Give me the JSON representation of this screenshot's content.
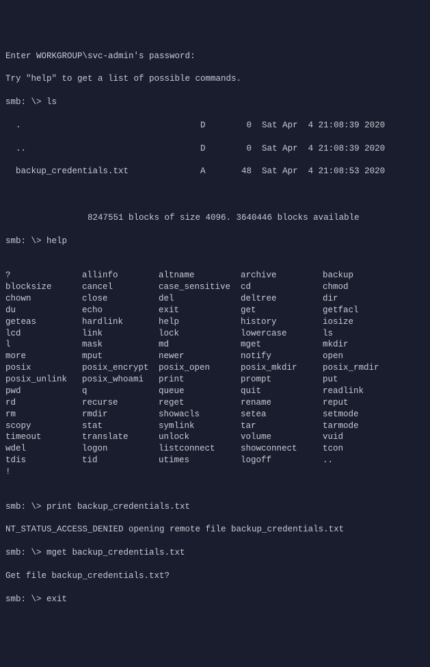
{
  "header": {
    "l1": "Enter WORKGROUP\\svc-admin's password:",
    "l2": "Try \"help\" to get a list of possible commands."
  },
  "prompt": "smb: \\> ",
  "cmds": {
    "ls": "ls",
    "help": "help",
    "print": "print backup_credentials.txt",
    "mget": "mget backup_credentials.txt",
    "exit": "exit"
  },
  "listing": {
    "r1": "  .                                   D        0  Sat Apr  4 21:08:39 2020",
    "r2": "  ..                                  D        0  Sat Apr  4 21:08:39 2020",
    "r3": "  backup_credentials.txt              A       48  Sat Apr  4 21:08:53 2020",
    "blocks": "                8247551 blocks of size 4096. 3640446 blocks available"
  },
  "help_rows": [
    [
      "?",
      "allinfo",
      "altname",
      "archive",
      "backup"
    ],
    [
      "blocksize",
      "cancel",
      "case_sensitive",
      "cd",
      "chmod"
    ],
    [
      "chown",
      "close",
      "del",
      "deltree",
      "dir"
    ],
    [
      "du",
      "echo",
      "exit",
      "get",
      "getfacl"
    ],
    [
      "geteas",
      "hardlink",
      "help",
      "history",
      "iosize"
    ],
    [
      "lcd",
      "link",
      "lock",
      "lowercase",
      "ls"
    ],
    [
      "l",
      "mask",
      "md",
      "mget",
      "mkdir"
    ],
    [
      "more",
      "mput",
      "newer",
      "notify",
      "open"
    ],
    [
      "posix",
      "posix_encrypt",
      "posix_open",
      "posix_mkdir",
      "posix_rmdir"
    ],
    [
      "posix_unlink",
      "posix_whoami",
      "print",
      "prompt",
      "put"
    ],
    [
      "pwd",
      "q",
      "queue",
      "quit",
      "readlink"
    ],
    [
      "rd",
      "recurse",
      "reget",
      "rename",
      "reput"
    ],
    [
      "rm",
      "rmdir",
      "showacls",
      "setea",
      "setmode"
    ],
    [
      "scopy",
      "stat",
      "symlink",
      "tar",
      "tarmode"
    ],
    [
      "timeout",
      "translate",
      "unlock",
      "volume",
      "vuid"
    ],
    [
      "wdel",
      "logon",
      "listconnect",
      "showconnect",
      "tcon"
    ],
    [
      "tdis",
      "tid",
      "utimes",
      "logoff",
      ".."
    ],
    [
      "!",
      "",
      "",
      "",
      ""
    ]
  ],
  "tail": {
    "denied": "NT_STATUS_ACCESS_DENIED opening remote file backup_credentials.txt",
    "getq": "Get file backup_credentials.txt? "
  }
}
